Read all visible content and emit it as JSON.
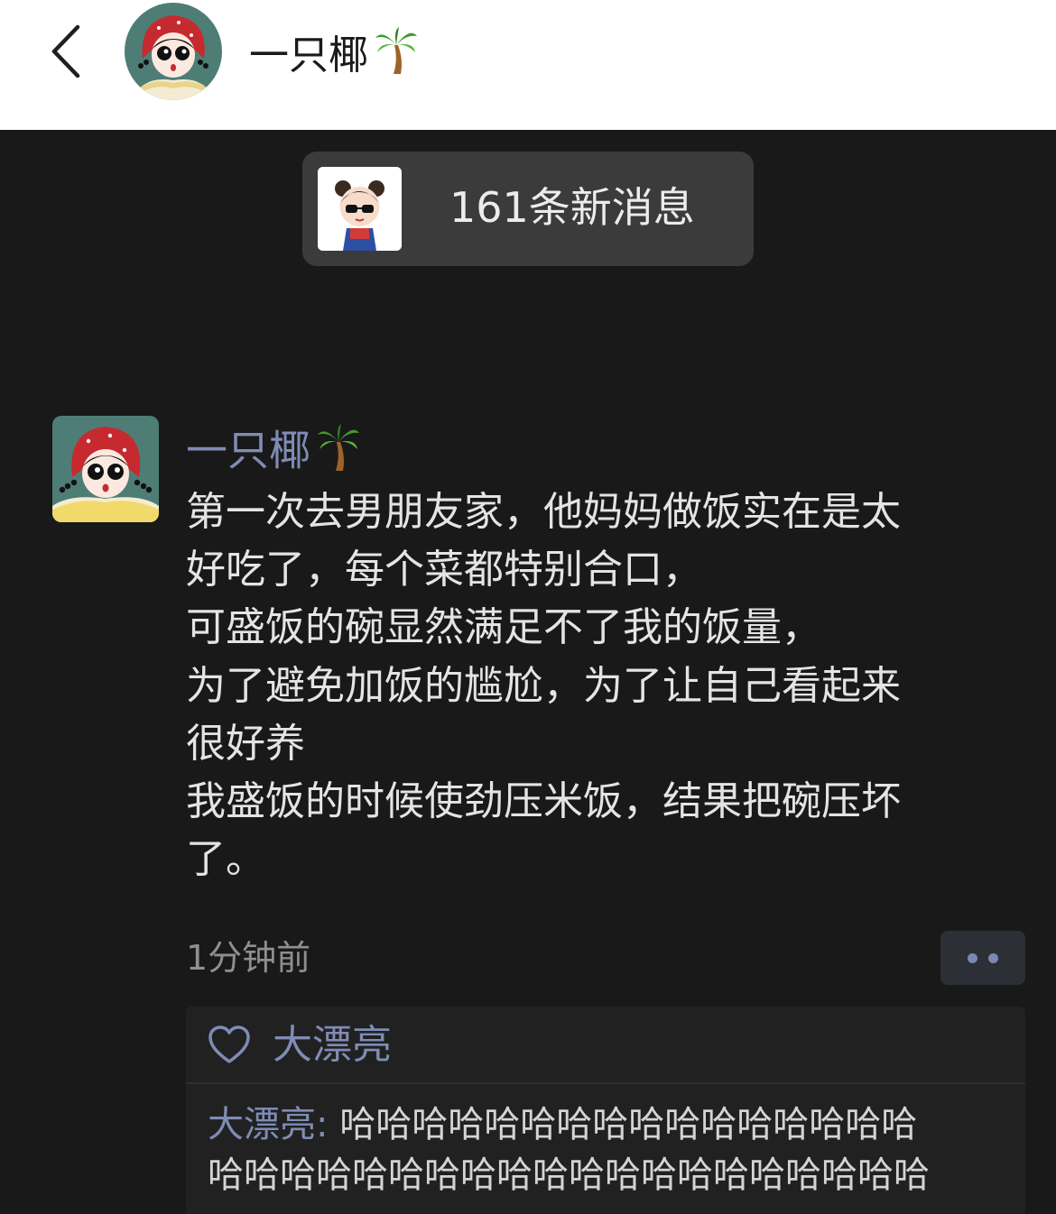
{
  "header": {
    "name": "一只椰",
    "back_icon": "chevron-left-icon",
    "emoji_icon": "palm-tree-icon"
  },
  "new_messages": {
    "label": "161条新消息"
  },
  "post": {
    "author": "一只椰",
    "lines": [
      "第一次去男朋友家，他妈妈做饭实在是太",
      "好吃了，每个菜都特别合口，",
      "可盛饭的碗显然满足不了我的饭量，",
      "为了避免加饭的尴尬，为了让自己看起来",
      "很好养",
      "我盛饭的时候使劲压米饭，结果把碗压坏",
      "了。"
    ],
    "time": "1分钟前"
  },
  "likes": {
    "names": "大漂亮",
    "icon": "heart-icon"
  },
  "comments": [
    {
      "author": "大漂亮",
      "separator": ": ",
      "line1": "哈哈哈哈哈哈哈哈哈哈哈哈哈哈哈哈",
      "line2": "哈哈哈哈哈哈哈哈哈哈哈哈哈哈哈哈哈哈哈哈"
    }
  ],
  "colors": {
    "background": "#191919",
    "header_bg": "#ffffff",
    "link_blue": "#7f8cb5",
    "body_text": "#e4e4e4",
    "muted_text": "#8f8f8f",
    "panel_bg": "#212121"
  }
}
